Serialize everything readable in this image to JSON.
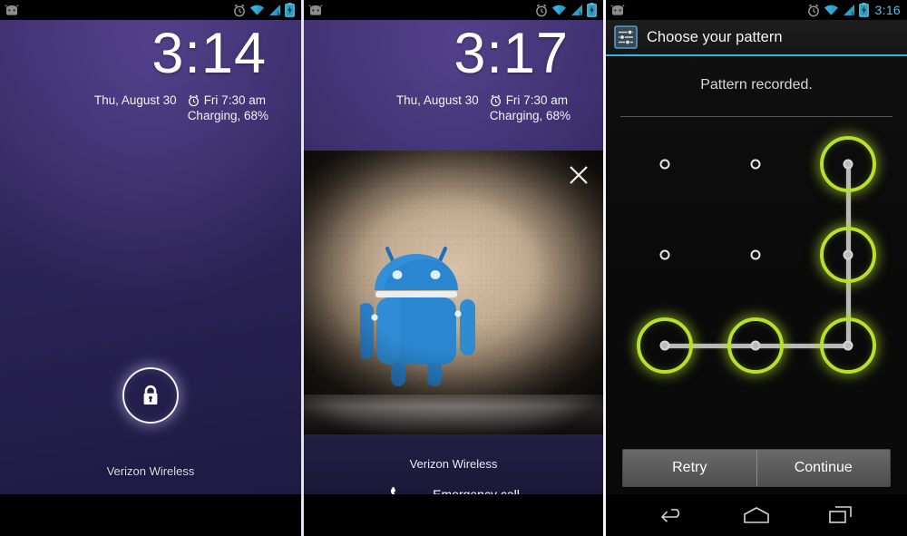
{
  "panels": [
    {
      "name": "lockscreen-clock",
      "status_bar": {
        "notification_icon": "android-head-icon",
        "icons": [
          "alarm-clock-icon",
          "wifi-icon",
          "signal-bars-icon",
          "battery-charging-icon"
        ],
        "clock": ""
      },
      "clock": {
        "hour": "3",
        "colon": ":",
        "minute": "14"
      },
      "date": "Thu, August 30",
      "alarm": "Fri 7:30 am",
      "battery_status": "Charging, 68%",
      "carrier": "Verizon Wireless",
      "lock_icon": "padlock-icon"
    },
    {
      "name": "lockscreen-camera-widget",
      "status_bar": {
        "notification_icon": "android-head-icon",
        "icons": [
          "alarm-clock-icon",
          "wifi-icon",
          "signal-bars-icon",
          "battery-charging-icon"
        ],
        "clock": ""
      },
      "clock": {
        "hour": "3",
        "colon": ":",
        "minute": "17"
      },
      "date": "Thu, August 30",
      "alarm": "Fri 7:30 am",
      "battery_status": "Charging, 68%",
      "photo_alt": "Blue Android figurine standing against a textured beige wall on a gray ledge",
      "close_icon": "close-icon",
      "carrier": "Verizon Wireless",
      "emergency_call": "Emergency call",
      "phone_icon": "phone-handset-icon"
    },
    {
      "name": "choose-pattern-settings",
      "status_bar": {
        "notification_icon": "android-head-icon",
        "icons": [
          "alarm-clock-icon",
          "wifi-icon",
          "signal-bars-icon",
          "battery-charging-icon"
        ],
        "clock": "3:16"
      },
      "action_bar": {
        "icon": "settings-sliders-icon",
        "title": "Choose your pattern"
      },
      "message": "Pattern recorded.",
      "buttons": {
        "retry": "Retry",
        "continue": "Continue"
      },
      "nav_bar": [
        "back-icon",
        "home-icon",
        "recents-icon"
      ]
    }
  ],
  "pattern": {
    "grid": 3,
    "selected_cells": [
      2,
      5,
      8,
      7,
      6
    ],
    "path_order": [
      "top-right",
      "middle-right",
      "bottom-right",
      "bottom-center",
      "bottom-left"
    ],
    "cell_states": [
      false,
      false,
      true,
      false,
      false,
      true,
      true,
      true,
      true
    ],
    "dot_positions_x": [
      65,
      165,
      267
    ],
    "dot_positions_y": [
      41,
      141,
      241
    ],
    "accent_color": "#b7e02a"
  },
  "colors": {
    "status_accent": "#33b5e5",
    "pattern_green": "#b7e02a",
    "lock_purple": "#312860",
    "nav_black": "#000000"
  }
}
